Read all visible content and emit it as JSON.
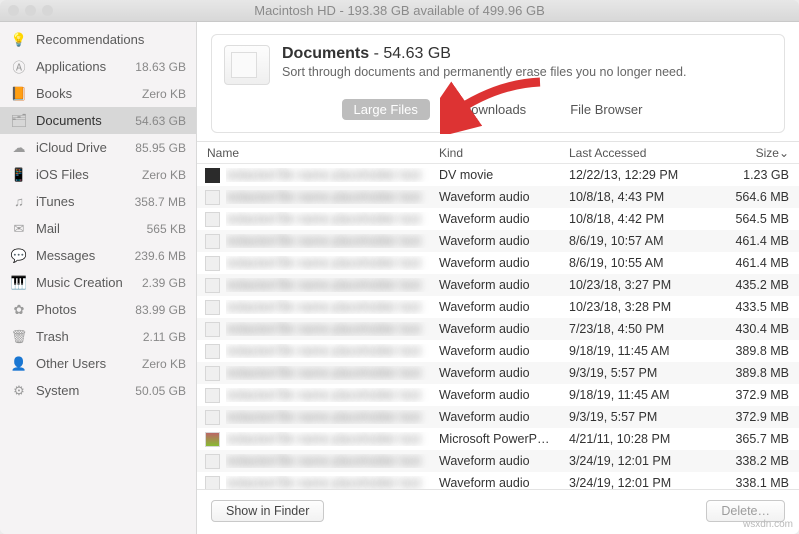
{
  "title": "Macintosh HD - 193.38 GB available of 499.96 GB",
  "sidebar": [
    {
      "icon": "lightbulb-icon",
      "label": "Recommendations",
      "size": ""
    },
    {
      "icon": "apps-icon",
      "label": "Applications",
      "size": "18.63 GB"
    },
    {
      "icon": "books-icon",
      "label": "Books",
      "size": "Zero KB"
    },
    {
      "icon": "documents-icon",
      "label": "Documents",
      "size": "54.63 GB",
      "active": true
    },
    {
      "icon": "icloud-icon",
      "label": "iCloud Drive",
      "size": "85.95 GB"
    },
    {
      "icon": "ios-icon",
      "label": "iOS Files",
      "size": "Zero KB"
    },
    {
      "icon": "itunes-icon",
      "label": "iTunes",
      "size": "358.7 MB"
    },
    {
      "icon": "mail-icon",
      "label": "Mail",
      "size": "565 KB"
    },
    {
      "icon": "messages-icon",
      "label": "Messages",
      "size": "239.6 MB"
    },
    {
      "icon": "music-icon",
      "label": "Music Creation",
      "size": "2.39 GB"
    },
    {
      "icon": "photos-icon",
      "label": "Photos",
      "size": "83.99 GB"
    },
    {
      "icon": "trash-icon",
      "label": "Trash",
      "size": "2.11 GB"
    },
    {
      "icon": "users-icon",
      "label": "Other Users",
      "size": "Zero KB"
    },
    {
      "icon": "system-icon",
      "label": "System",
      "size": "50.05 GB"
    }
  ],
  "header": {
    "title_name": "Documents",
    "title_sep": " - ",
    "title_size": "54.63 GB",
    "subtitle": "Sort through documents and permanently erase files you no longer need."
  },
  "tabs": {
    "large_files": "Large Files",
    "downloads": "Downloads",
    "file_browser": "File Browser"
  },
  "columns": {
    "name": "Name",
    "kind": "Kind",
    "accessed": "Last Accessed",
    "size": "Size"
  },
  "rows": [
    {
      "kind": "DV movie",
      "acc": "12/22/13, 12:29 PM",
      "size": "1.23 GB",
      "ic": "dark"
    },
    {
      "kind": "Waveform audio",
      "acc": "10/8/18, 4:43 PM",
      "size": "564.6 MB",
      "ic": "doc"
    },
    {
      "kind": "Waveform audio",
      "acc": "10/8/18, 4:42 PM",
      "size": "564.5 MB",
      "ic": "doc"
    },
    {
      "kind": "Waveform audio",
      "acc": "8/6/19, 10:57 AM",
      "size": "461.4 MB",
      "ic": "doc"
    },
    {
      "kind": "Waveform audio",
      "acc": "8/6/19, 10:55 AM",
      "size": "461.4 MB",
      "ic": "doc"
    },
    {
      "kind": "Waveform audio",
      "acc": "10/23/18, 3:27 PM",
      "size": "435.2 MB",
      "ic": "doc"
    },
    {
      "kind": "Waveform audio",
      "acc": "10/23/18, 3:28 PM",
      "size": "433.5 MB",
      "ic": "doc"
    },
    {
      "kind": "Waveform audio",
      "acc": "7/23/18, 4:50 PM",
      "size": "430.4 MB",
      "ic": "doc"
    },
    {
      "kind": "Waveform audio",
      "acc": "9/18/19, 11:45 AM",
      "size": "389.8 MB",
      "ic": "doc"
    },
    {
      "kind": "Waveform audio",
      "acc": "9/3/19, 5:57 PM",
      "size": "389.8 MB",
      "ic": "doc"
    },
    {
      "kind": "Waveform audio",
      "acc": "9/18/19, 11:45 AM",
      "size": "372.9 MB",
      "ic": "doc"
    },
    {
      "kind": "Waveform audio",
      "acc": "9/3/19, 5:57 PM",
      "size": "372.9 MB",
      "ic": "doc"
    },
    {
      "kind": "Microsoft PowerP…",
      "acc": "4/21/11, 10:28 PM",
      "size": "365.7 MB",
      "ic": "ppt"
    },
    {
      "kind": "Waveform audio",
      "acc": "3/24/19, 12:01 PM",
      "size": "338.2 MB",
      "ic": "doc"
    },
    {
      "kind": "Waveform audio",
      "acc": "3/24/19, 12:01 PM",
      "size": "338.1 MB",
      "ic": "doc"
    }
  ],
  "footer": {
    "show_in_finder": "Show in Finder",
    "delete": "Delete…"
  },
  "watermark": "wsxdn.com"
}
